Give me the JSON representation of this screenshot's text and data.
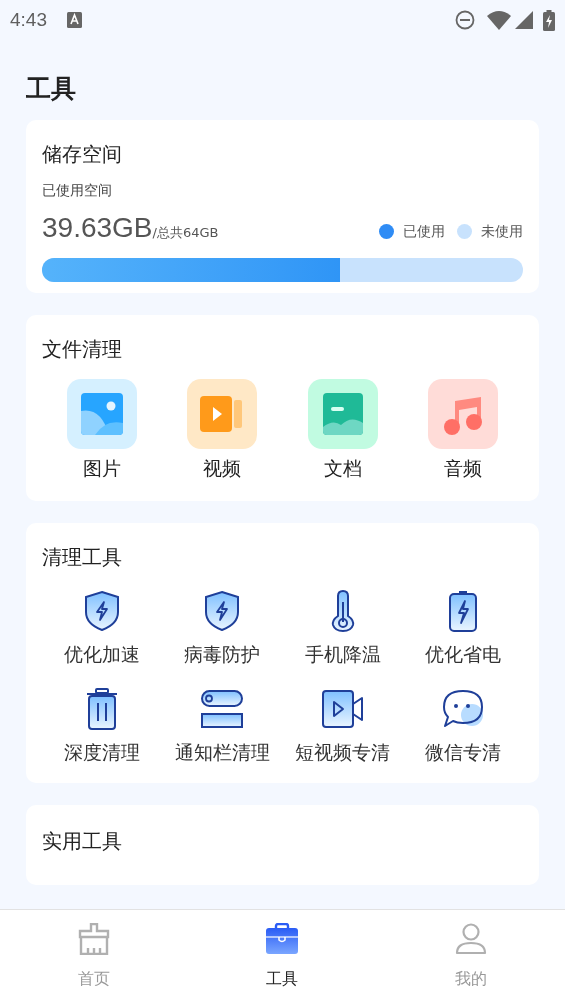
{
  "status_bar": {
    "time": "4:43"
  },
  "title": "工具",
  "storage": {
    "title": "储存空间",
    "subtitle": "已使用空间",
    "used": "39.63GB",
    "total": "/总共64GB",
    "legend": [
      {
        "label": "已使用",
        "color": "#2f8cf5"
      },
      {
        "label": "未使用",
        "color": "#c8e2fd"
      }
    ],
    "level": 0.62
  },
  "file_clean": {
    "title": "文件清理",
    "items": [
      {
        "kind": "image",
        "label": "图片"
      },
      {
        "kind": "video",
        "label": "视频"
      },
      {
        "kind": "document",
        "label": "文档"
      },
      {
        "kind": "audio",
        "label": "音频"
      }
    ]
  },
  "clean_tools": {
    "title": "清理工具",
    "items": [
      {
        "kind": "shield",
        "label": "优化加速"
      },
      {
        "kind": "shield",
        "label": "病毒防护"
      },
      {
        "kind": "thermometer",
        "label": "手机降温"
      },
      {
        "kind": "battery",
        "label": "优化省电"
      },
      {
        "kind": "trash",
        "label": "深度清理"
      },
      {
        "kind": "toggle",
        "label": "通知栏清理"
      },
      {
        "kind": "video",
        "label": "短视频专清"
      },
      {
        "kind": "chat",
        "label": "微信专清"
      }
    ]
  },
  "practical_tools": {
    "title": "实用工具"
  },
  "tabs": [
    {
      "kind": "broom",
      "label": "首页",
      "selected": false
    },
    {
      "kind": "toolbox",
      "label": "工具",
      "selected": true
    },
    {
      "kind": "person",
      "label": "我的",
      "selected": false
    }
  ]
}
